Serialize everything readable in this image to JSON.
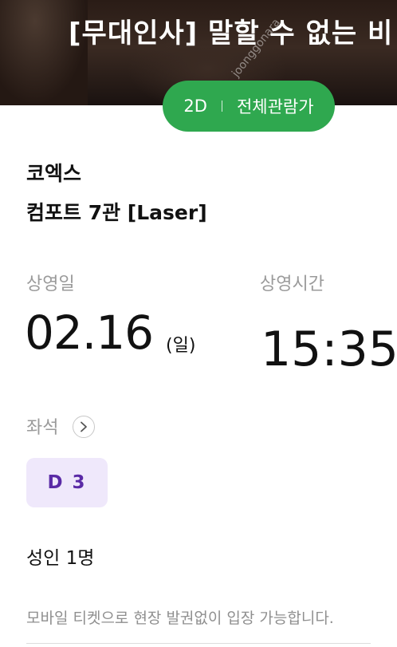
{
  "hero": {
    "title": "[무대인사] 말할 수 없는 비",
    "watermark": "joonggonara"
  },
  "badges": {
    "format": "2D",
    "rating": "전체관람가"
  },
  "theater": {
    "name": "코엑스",
    "screen": "컴포트 7관 [Laser]"
  },
  "showing": {
    "date_label": "상영일",
    "date": "02.16",
    "day": "(일)",
    "time_label": "상영시간",
    "time": "15:35"
  },
  "seat": {
    "label": "좌석",
    "value": "D 3"
  },
  "audience": "성인 1명",
  "notice": "모바일 티켓으로 현장 발권없이 입장 가능합니다."
}
